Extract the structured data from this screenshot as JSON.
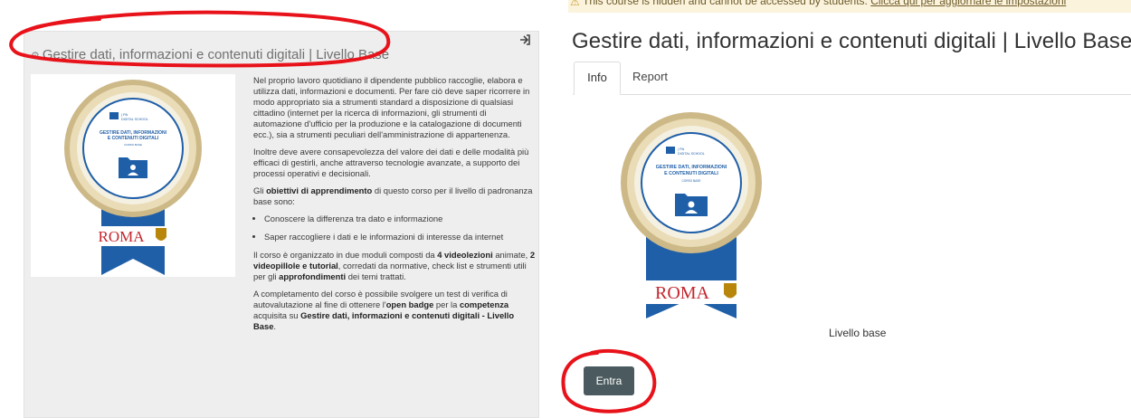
{
  "left": {
    "course_title": "Gestire dati, informazioni e contenuti digitali | Livello Base",
    "gear_icon": "gear-icon",
    "enter_icon": "sign-in-icon",
    "badge": {
      "org_small": "| PA",
      "org_big": "DIGITAL SCHOOL",
      "title_line1": "GESTIRE DATI, INFORMAZIONI",
      "title_line2": "E CONTENUTI DIGITALI",
      "subtitle": "CORSO BASE",
      "city": "ROMA"
    },
    "para1": "Nel proprio lavoro quotidiano il dipendente pubblico raccoglie, elabora e utilizza dati, informazioni e documenti. Per fare ciò deve saper ricorrere in modo appropriato sia a strumenti standard a disposizione di qualsiasi cittadino (internet per la ricerca di informazioni, gli strumenti di automazione d'ufficio per la produzione e la catalogazione di documenti ecc.), sia a strumenti peculiari dell'amministrazione di appartenenza.",
    "para2": "Inoltre deve avere consapevolezza del valore dei dati e delle modalità più efficaci di gestirli, anche attraverso tecnologie avanzate, a supporto dei processi operativi e decisionali.",
    "para3_a": "Gli ",
    "para3_b": "obiettivi di apprendimento",
    "para3_c": " di questo corso per il livello di padronanza base sono:",
    "bullet1": "Conoscere la differenza tra dato e informazione",
    "bullet2": "Saper raccogliere i dati e le informazioni di interesse da internet",
    "para4_a": "Il corso è organizzato in due moduli composti da ",
    "para4_b": "4 videolezioni",
    "para4_c": " animate, ",
    "para4_d": "2 videopillole e tutorial",
    "para4_e": ", corredati da normative, check list e strumenti utili per gli ",
    "para4_f": "approfondimenti",
    "para4_g": " dei temi trattati.",
    "para5_a": "A completamento del corso è possibile svolgere un test di verifica di autovalutazione al fine di ottenere l'",
    "para5_b": "open badge",
    "para5_c": " per la ",
    "para5_d": "competenza",
    "para5_e": " acquisita su ",
    "para5_f": "Gestire dati, informazioni e contenuti digitali - Livello Base",
    "para5_g": "."
  },
  "right": {
    "warning_prefix": "This course is hidden and cannot be accessed by students. ",
    "warning_link": "Clicca qui per aggiornare le impostazioni",
    "warning_icon": "warning-icon",
    "title": "Gestire dati, informazioni e contenuti digitali | Livello Base",
    "tabs": [
      {
        "label": "Info",
        "active": true
      },
      {
        "label": "Report",
        "active": false
      }
    ],
    "level_label": "Livello base",
    "enter_button": "Entra"
  },
  "colors": {
    "annotation_red": "#e8121a",
    "button_bg": "#4b5a5e",
    "warning_bg": "#fcf3dd",
    "badge_blue": "#1f5fa8",
    "badge_gold": "#c8b27a"
  }
}
